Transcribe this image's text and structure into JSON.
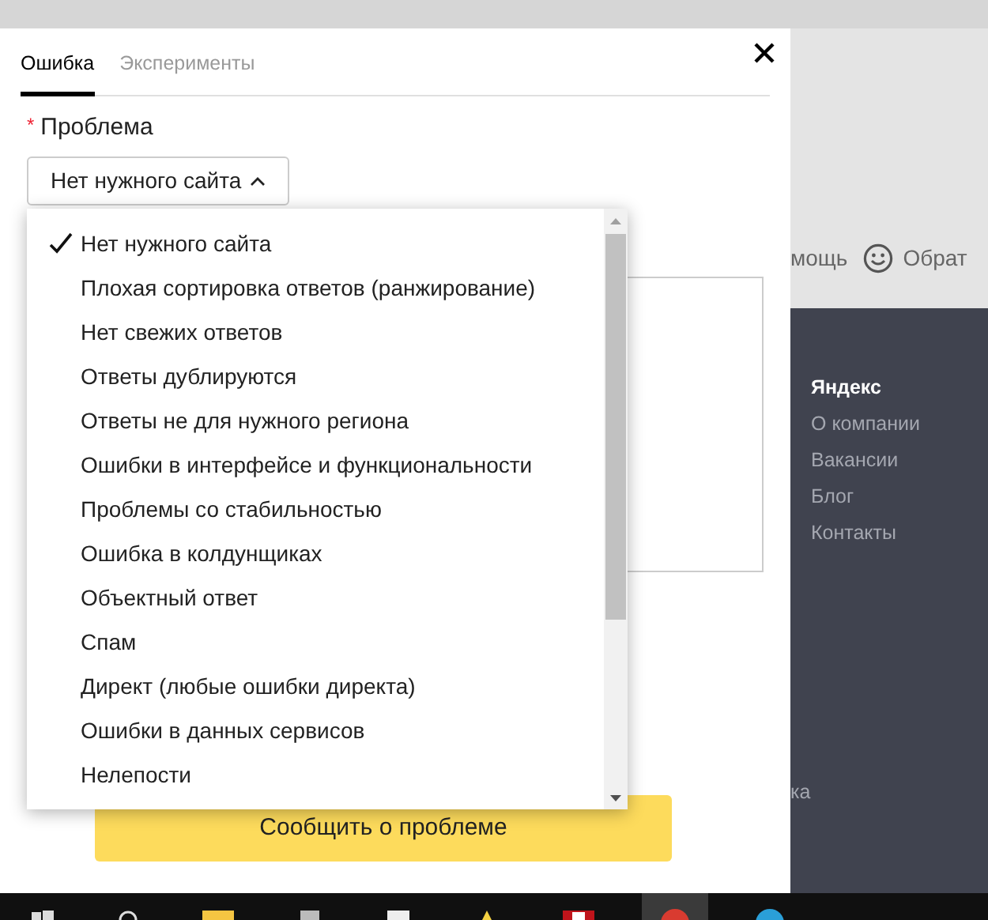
{
  "dialog": {
    "tabs": [
      {
        "label": "Ошибка",
        "selected": true
      },
      {
        "label": "Эксперименты",
        "selected": false
      }
    ],
    "field_label": "Проблема",
    "required_mark": "*",
    "select": {
      "value": "Нет нужного сайта",
      "expanded": true
    },
    "options": [
      {
        "label": "Нет нужного сайта",
        "selected": true
      },
      {
        "label": "Плохая сортировка ответов (ранжирование)",
        "selected": false
      },
      {
        "label": "Нет свежих ответов",
        "selected": false
      },
      {
        "label": "Ответы дублируются",
        "selected": false
      },
      {
        "label": "Ответы не для нужного региона",
        "selected": false
      },
      {
        "label": "Ошибки в интерфейсе и функциональности",
        "selected": false
      },
      {
        "label": "Проблемы со стабильностью",
        "selected": false
      },
      {
        "label": "Ошибка в колдунщиках",
        "selected": false
      },
      {
        "label": "Объектный ответ",
        "selected": false
      },
      {
        "label": "Спам",
        "selected": false
      },
      {
        "label": "Директ (любые ошибки директа)",
        "selected": false
      },
      {
        "label": "Ошибки в данных сервисов",
        "selected": false
      },
      {
        "label": "Нелепости",
        "selected": false
      }
    ],
    "submit": "Сообщить о проблеме"
  },
  "background": {
    "toolbar": [
      "мощь",
      "Обрат"
    ],
    "footer_links": [
      {
        "label": "Яндекс",
        "selected": true
      },
      {
        "label": "О компании",
        "selected": false
      },
      {
        "label": "Вакансии",
        "selected": false
      },
      {
        "label": "Блог",
        "selected": false
      },
      {
        "label": "Контакты",
        "selected": false
      }
    ],
    "footer_cut": "ка"
  }
}
